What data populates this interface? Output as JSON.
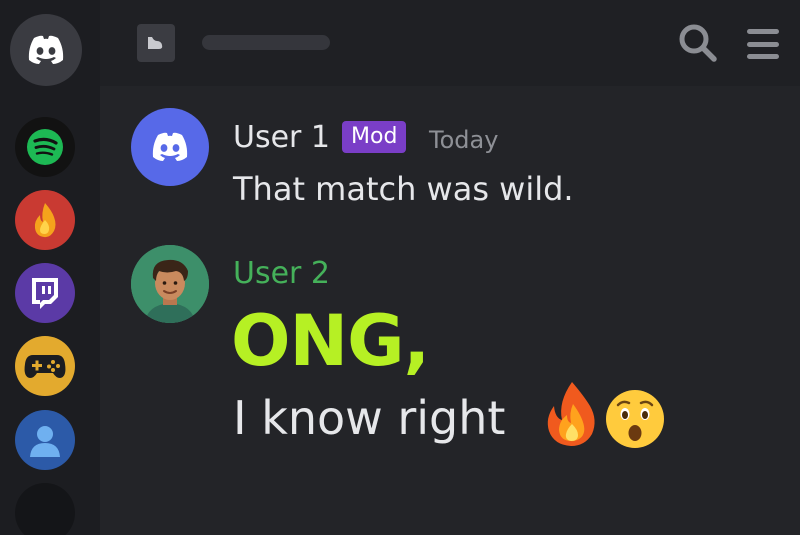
{
  "servers": [
    {
      "name": "discord-home",
      "icon": "discord-logo-icon"
    },
    {
      "name": "spotify",
      "icon": "spotify-icon",
      "color": "#1db954"
    },
    {
      "name": "fire",
      "icon": "flame-icon",
      "color": "#c93a32"
    },
    {
      "name": "twitch",
      "icon": "twitch-icon",
      "color": "#5b3aa6"
    },
    {
      "name": "games",
      "icon": "gamepad-icon",
      "color": "#e3aa2e"
    },
    {
      "name": "user",
      "icon": "person-icon",
      "color": "#2c5aa8"
    },
    {
      "name": "empty",
      "icon": ""
    }
  ],
  "header": {
    "channel_icon": "channel-icon",
    "search_icon": "search-icon",
    "menu_icon": "hamburger-menu-icon"
  },
  "messages": [
    {
      "author": "User 1",
      "role_badge": "Mod",
      "timestamp": "Today",
      "text": "That match was wild.",
      "avatar": "discord-logo-icon",
      "name_color": "#e6e7ea"
    },
    {
      "author": "User 2",
      "big_text": "ONG,",
      "text": "I know right",
      "emojis": [
        "fire-emoji",
        "astonished-face-emoji"
      ],
      "avatar": "cartoon-man-avatar",
      "name_color": "#45b15a",
      "big_text_color": "#b6f024"
    }
  ],
  "colors": {
    "badge": "#7a3ec7",
    "background": "#232428",
    "rail": "#1c1d21"
  }
}
